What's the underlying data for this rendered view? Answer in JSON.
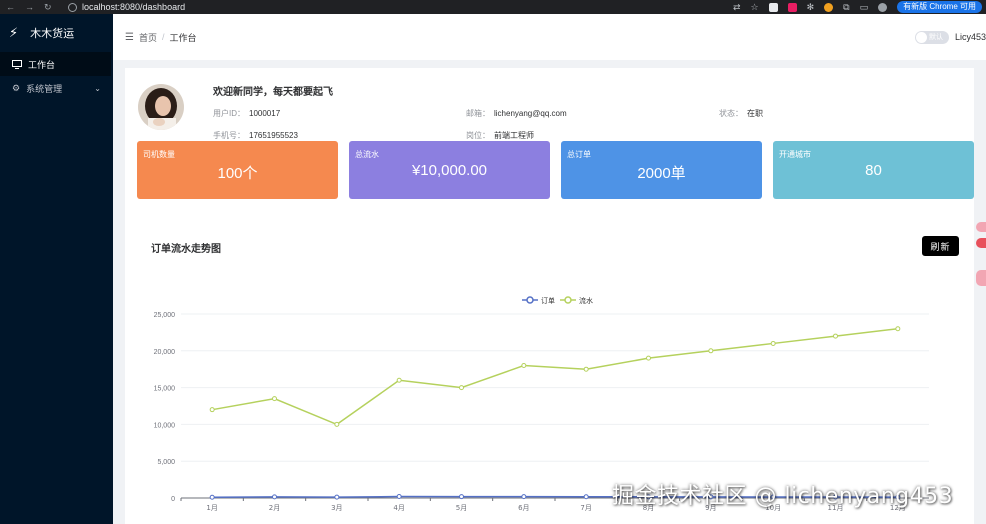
{
  "browser": {
    "url": "localhost:8080/dashboard",
    "update_label": "有新版 Chrome 可用"
  },
  "sidebar": {
    "brand": "木木货运",
    "items": [
      {
        "label": "工作台",
        "icon": "monitor-icon",
        "active": true
      },
      {
        "label": "系统管理",
        "icon": "gear-icon",
        "active": false
      }
    ]
  },
  "header": {
    "breadcrumb": [
      "首页",
      "工作台"
    ],
    "theme_toggle_label": "默认",
    "username": "Licy453"
  },
  "profile": {
    "welcome": "欢迎新同学，每天都要起飞",
    "fields": [
      {
        "label": "用户ID：",
        "value": "1000017"
      },
      {
        "label": "邮箱：",
        "value": "lichenyang@qq.com"
      },
      {
        "label": "状态：",
        "value": "在职"
      },
      {
        "label": "手机号：",
        "value": "17651955523"
      },
      {
        "label": "岗位：",
        "value": "前端工程师"
      }
    ]
  },
  "stats": [
    {
      "label": "司机数量",
      "value": "100个",
      "color": "#f5894f"
    },
    {
      "label": "总流水",
      "value": "¥10,000.00",
      "color": "#8c7fe0"
    },
    {
      "label": "总订单",
      "value": "2000单",
      "color": "#4e93e6"
    },
    {
      "label": "开通城市",
      "value": "80",
      "color": "#6ec1d6"
    }
  ],
  "chart_section": {
    "title": "订单流水走势图",
    "refresh_label": "刷新"
  },
  "chart_data": {
    "type": "line",
    "categories": [
      "1月",
      "2月",
      "3月",
      "4月",
      "5月",
      "6月",
      "7月",
      "8月",
      "9月",
      "10月",
      "11月",
      "12月"
    ],
    "series": [
      {
        "name": "订单",
        "color": "#5470c6",
        "values": [
          100,
          150,
          120,
          200,
          180,
          190,
          170,
          160,
          150,
          140,
          130,
          120
        ]
      },
      {
        "name": "流水",
        "color": "#b5d15d",
        "values": [
          12000,
          13500,
          10000,
          16000,
          15000,
          18000,
          17500,
          19000,
          20000,
          21000,
          22000,
          23000
        ]
      }
    ],
    "yticks": [
      0,
      5000,
      10000,
      15000,
      20000,
      25000
    ],
    "ytick_labels": [
      "0",
      "5,000",
      "10,000",
      "15,000",
      "20,000",
      "25,000"
    ],
    "ylim": [
      0,
      25000
    ],
    "legend_position": "top-center",
    "grid": true
  },
  "watermark": "掘金技术社区 @ lichenyang453"
}
